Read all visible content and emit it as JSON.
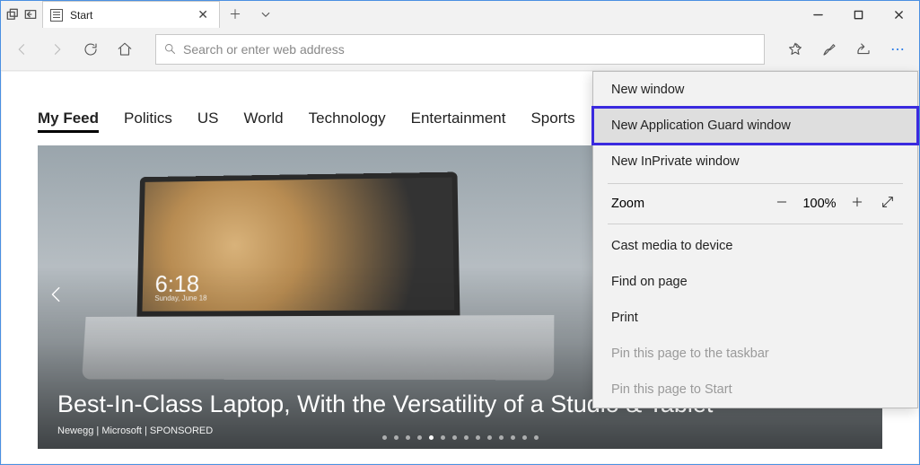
{
  "tab": {
    "title": "Start"
  },
  "address": {
    "placeholder": "Search or enter web address"
  },
  "feed_nav": {
    "items": [
      {
        "label": "My Feed",
        "active": true
      },
      {
        "label": "Politics"
      },
      {
        "label": "US"
      },
      {
        "label": "World"
      },
      {
        "label": "Technology"
      },
      {
        "label": "Entertainment"
      },
      {
        "label": "Sports"
      }
    ]
  },
  "hero": {
    "clock_time": "6:18",
    "clock_date": "Sunday, June 18",
    "headline": "Best-In-Class Laptop, With the Versatility of a Studio & Tablet",
    "source": "Newegg | Microsoft | SPONSORED",
    "dot_count": 14,
    "active_dot": 4
  },
  "menu": {
    "new_window": "New window",
    "new_app_guard": "New Application Guard window",
    "new_inprivate": "New InPrivate window",
    "zoom_label": "Zoom",
    "zoom_value": "100%",
    "cast": "Cast media to device",
    "find": "Find on page",
    "print": "Print",
    "pin_taskbar": "Pin this page to the taskbar",
    "pin_start": "Pin this page to Start"
  }
}
